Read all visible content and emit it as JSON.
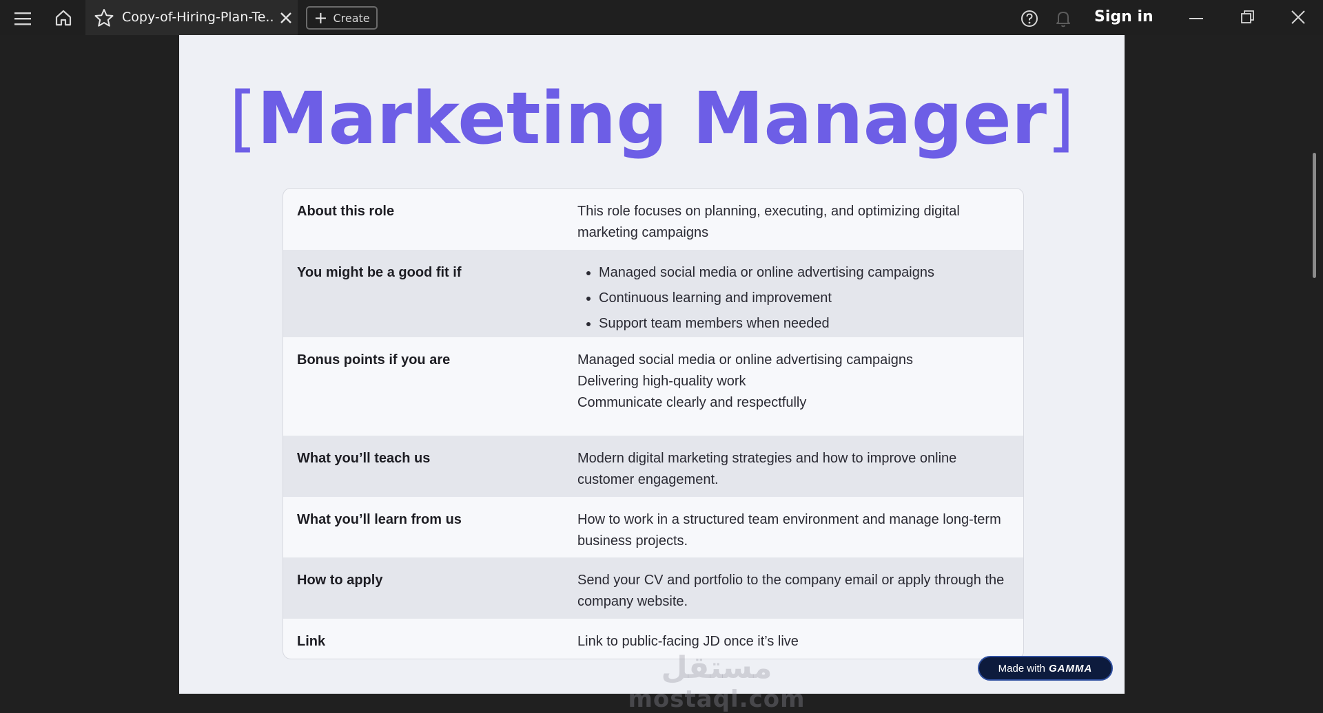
{
  "titlebar": {
    "tab_title": "Copy-of-Hiring-Plan-Te...",
    "create_label": "Create",
    "signin_label": "Sign in",
    "icons": [
      "menu-icon",
      "home-icon",
      "star-icon",
      "close-icon",
      "plus-icon",
      "help-icon",
      "bell-icon",
      "minimize-icon",
      "restore-icon",
      "window-close-icon"
    ]
  },
  "document": {
    "title_open": "[",
    "title": "Marketing Manager",
    "title_close": "]",
    "title_color": "#6d5ee6",
    "rows": [
      {
        "label": "About this role",
        "text": "This role focuses on planning, executing, and optimizing digital marketing campaigns"
      },
      {
        "label": "You might be a good fit if",
        "bullets": [
          "Managed social media or online advertising campaigns",
          "Continuous learning and improvement",
          "Support team members when needed"
        ]
      },
      {
        "label": "Bonus points if you are",
        "lines": [
          "Managed social media or online advertising campaigns",
          "Delivering high-quality work",
          "Communicate clearly and respectfully"
        ]
      },
      {
        "label": "What you’ll teach us",
        "text": "Modern digital marketing strategies and how to improve online customer engagement."
      },
      {
        "label": "What you’ll learn from us",
        "text": "How to work in a structured team environment and manage long-term business projects."
      },
      {
        "label": "How to apply",
        "text": "Send your CV and portfolio to the company email or apply through the company website."
      },
      {
        "label": "Link",
        "text": "Link to public-facing JD once it’s live"
      }
    ]
  },
  "watermark": {
    "arabic": "مستقل",
    "latin": "mostaql.com"
  },
  "badge": {
    "prefix": "Made with",
    "brand": "GAMMA",
    "color": "#0d1b3d"
  }
}
